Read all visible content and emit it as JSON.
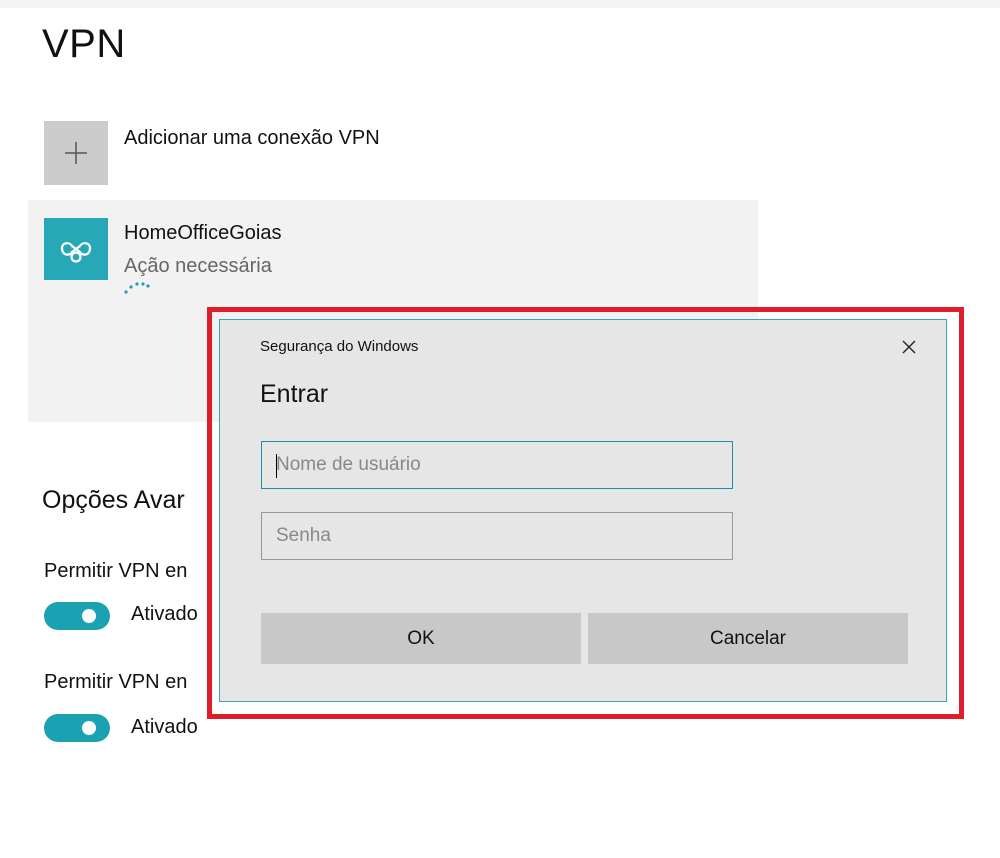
{
  "page": {
    "title": "VPN"
  },
  "add_connection": {
    "icon": "plus-icon",
    "label": "Adicionar uma conexão VPN"
  },
  "vpn_connection": {
    "icon": "vpn-connection-icon",
    "name": "HomeOfficeGoias",
    "status": "Ação necessária"
  },
  "advanced_options": {
    "title": "Opções Avar",
    "options": [
      {
        "label": "Permitir VPN en",
        "state": "Ativado",
        "enabled": true
      },
      {
        "label": "Permitir VPN en",
        "state": "Ativado",
        "enabled": true
      }
    ]
  },
  "dialog": {
    "caption": "Segurança do Windows",
    "heading": "Entrar",
    "username": {
      "value": "",
      "placeholder": "Nome de usuário"
    },
    "password": {
      "value": "",
      "placeholder": "Senha"
    },
    "ok_label": "OK",
    "cancel_label": "Cancelar",
    "close_icon": "close-icon"
  },
  "colors": {
    "accent": "#1aa1b2",
    "highlight_frame": "#e01e2b",
    "dialog_bg": "#e6e6e6",
    "dialog_border": "#3ea3b8"
  }
}
